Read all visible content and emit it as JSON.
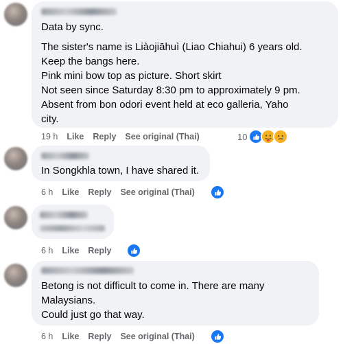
{
  "comments": [
    {
      "lines": [
        "Data by sync.",
        "",
        "The sister's name is Liàojiāhuì (Liao Chiahui) 6 years old.",
        "Keep the bangs here.",
        "Pink mini bow top as picture. Short skirt",
        "Not seen since Saturday 8:30 pm to approximately 9 pm.",
        "Absent from bon odori event held at eco galleria, Yaho",
        "city."
      ],
      "time": "19 h",
      "like": "Like",
      "reply": "Reply",
      "see_original": "See original (Thai)",
      "reaction_count": "10"
    },
    {
      "lines": [
        "In Songkhla town, I have shared it."
      ],
      "time": "6 h",
      "like": "Like",
      "reply": "Reply",
      "see_original": "See original (Thai)"
    },
    {
      "time": "6 h",
      "like": "Like",
      "reply": "Reply"
    },
    {
      "lines": [
        "Betong is not difficult to come in. There are many",
        "Malaysians.",
        "Could just go that way."
      ],
      "time": "6 h",
      "like": "Like",
      "reply": "Reply",
      "see_original": "See original (Thai)"
    }
  ],
  "icons": [
    "like-reaction-icon",
    "care-reaction-icon",
    "sad-reaction-icon"
  ],
  "colors": {
    "bubble": "#f0f2f5",
    "like_blue": "#1877f2",
    "meta": "#65676b"
  }
}
